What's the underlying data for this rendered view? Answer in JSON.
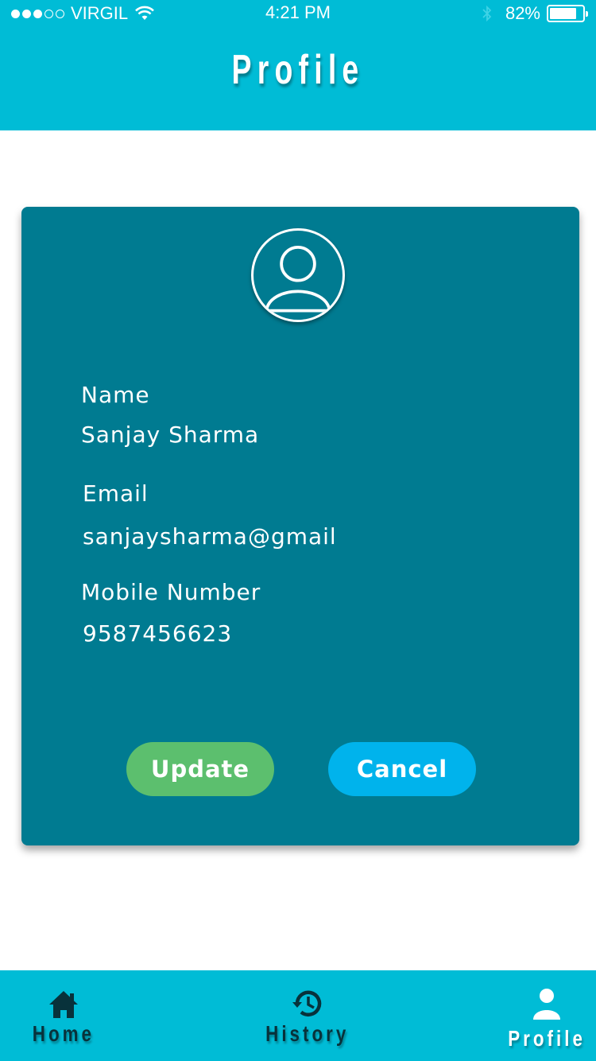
{
  "status_bar": {
    "carrier": "VIRGIL",
    "time": "4:21 PM",
    "battery": "82%",
    "battery_level": 0.82
  },
  "header": {
    "title": "Profile"
  },
  "profile": {
    "avatar_icon": "user-circle-icon",
    "fields": [
      {
        "label": "Name",
        "value": "Sanjay Sharma"
      },
      {
        "label": "Email",
        "value": "sanjaysharma@gmail"
      },
      {
        "label": "Mobile Number",
        "value": "9587456623"
      }
    ],
    "update_label": "Update",
    "cancel_label": "Cancel"
  },
  "bottom_nav": {
    "items": [
      {
        "label": "Home",
        "icon": "home-icon"
      },
      {
        "label": "History",
        "icon": "history-icon"
      },
      {
        "label": "Profile",
        "icon": "user-icon",
        "active": true
      }
    ]
  },
  "colors": {
    "primary": "#00bcd6",
    "card": "#007b91",
    "update": "#5cbf6e",
    "cancel": "#00b3ec",
    "nav_text": "#08323b"
  }
}
